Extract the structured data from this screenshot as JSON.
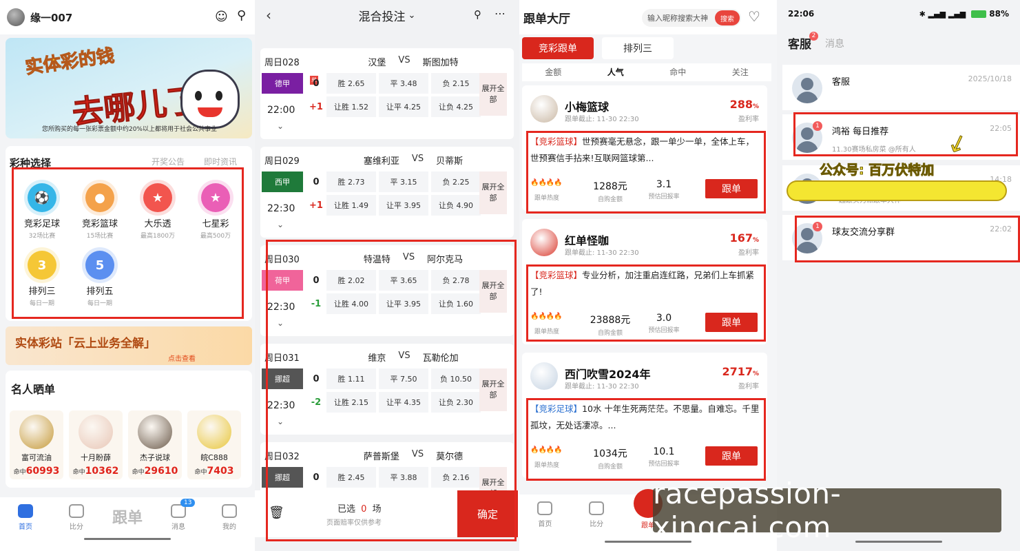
{
  "panel1": {
    "username": "缘一007",
    "banner": {
      "line1": "实体彩的钱",
      "line2": "去哪儿了?",
      "note": "您所购买的每一张彩票金额中约20%以上都将用于社会公共事业"
    },
    "section_title": "彩种选择",
    "section_links": [
      "开奖公告",
      "即时资讯"
    ],
    "lotteries": [
      {
        "name": "竞彩足球",
        "sub": "32场比赛",
        "color": "#35b6e8",
        "glyph": "⚽"
      },
      {
        "name": "竞彩篮球",
        "sub": "15场比赛",
        "color": "#f4a24b",
        "glyph": "●"
      },
      {
        "name": "大乐透",
        "sub": "最高1800万",
        "color": "#f2554e",
        "glyph": "★"
      },
      {
        "name": "七星彩",
        "sub": "最高500万",
        "color": "#ea5fb6",
        "glyph": "★"
      },
      {
        "name": "排列三",
        "sub": "每日一期",
        "color": "#f5c736",
        "glyph": "3"
      },
      {
        "name": "排列五",
        "sub": "每日一期",
        "color": "#5b8ff0",
        "glyph": "5"
      }
    ],
    "promo": {
      "title": "实体彩站「云上业务全解」",
      "link": "点击查看"
    },
    "celeb_title": "名人晒单",
    "celebs": [
      {
        "name": "富可流油",
        "hit_label": "命中",
        "hit": "60993"
      },
      {
        "name": "十月盼薛",
        "hit_label": "命中",
        "hit": "10362"
      },
      {
        "name": "杰子说球",
        "hit_label": "命中",
        "hit": "29610"
      },
      {
        "name": "皖C888",
        "hit_label": "命中",
        "hit": "7403"
      }
    ],
    "tabs": [
      {
        "label": "首页",
        "active": true
      },
      {
        "label": "比分"
      },
      {
        "label": "跟单"
      },
      {
        "label": "消息",
        "badge": "13"
      },
      {
        "label": "我的"
      }
    ]
  },
  "panel2": {
    "title": "混合投注",
    "matches": [
      {
        "week": "周日028",
        "league": "德甲",
        "league_color": "#7a1fa2",
        "time": "22:00",
        "home": "汉堡",
        "away": "斯图加特",
        "h0": "0",
        "h1": "+1",
        "odds": [
          "胜 2.65",
          "平 3.48",
          "负 2.15"
        ],
        "hodds": [
          "让胜 1.52",
          "让平 4.25",
          "让负 4.25"
        ],
        "flag": "单"
      },
      {
        "week": "周日029",
        "league": "西甲",
        "league_color": "#1f7a3a",
        "time": "22:30",
        "home": "塞维利亚",
        "away": "贝蒂斯",
        "h0": "0",
        "h1": "+1",
        "odds": [
          "胜 2.73",
          "平 3.15",
          "负 2.25"
        ],
        "hodds": [
          "让胜 1.49",
          "让平 3.95",
          "让负 4.90"
        ]
      },
      {
        "week": "周日030",
        "league": "荷甲",
        "league_color": "#f0649a",
        "time": "22:30",
        "home": "特温特",
        "away": "阿尔克马",
        "h0": "0",
        "h1": "-1",
        "odds": [
          "胜 2.02",
          "平 3.65",
          "负 2.78"
        ],
        "hodds": [
          "让胜 4.00",
          "让平 3.95",
          "让负 1.60"
        ]
      },
      {
        "week": "周日031",
        "league": "挪超",
        "league_color": "#555555",
        "time": "22:30",
        "home": "维京",
        "away": "瓦勒伦加",
        "h0": "0",
        "h1": "-2",
        "odds": [
          "胜 1.11",
          "平 7.50",
          "负 10.50"
        ],
        "hodds": [
          "让胜 2.15",
          "让平 4.35",
          "让负 2.30"
        ]
      },
      {
        "week": "周日032",
        "league": "挪超",
        "league_color": "#555555",
        "time": "",
        "home": "萨普斯堡",
        "away": "莫尔德",
        "h0": "0",
        "h1": "",
        "odds": [
          "胜 2.45",
          "平 3.88",
          "负 2.16"
        ],
        "hodds": [
          "",
          "",
          ""
        ]
      }
    ],
    "vs": "VS",
    "expand": "展开全部",
    "selected_prefix": "已选",
    "selected_count": "0",
    "selected_suffix": "场",
    "note": "页面赔率仅供参考",
    "confirm": "确定"
  },
  "panel3": {
    "title": "跟单大厅",
    "search_placeholder": "输入昵称搜索大神",
    "search_button": "搜索",
    "seg_active": "竞彩跟单",
    "seg_other": "排列三",
    "subtabs": [
      "金额",
      "人气",
      "命中",
      "关注"
    ],
    "users": [
      {
        "name": "小梅篮球",
        "deadline": "跟单截止: 11-30 22:30",
        "rate": "288",
        "rate_label": "盈利率",
        "tag": "【竞彩篮球】",
        "text": "世预赛毫无悬念，跟一单少一单，全体上车，世预赛信手拈来!互联网篮球第...",
        "amount": "1288元",
        "amount_label": "自购金额",
        "ret": "3.1",
        "ret_label": "预估回报率",
        "heat_label": "跟单热度",
        "follow": "跟单",
        "tag_color": "red"
      },
      {
        "name": "红单怪咖",
        "deadline": "跟单截止: 11-30 22:30",
        "rate": "167",
        "rate_label": "盈利率",
        "tag": "【竞彩篮球】",
        "text": "专业分析，加注重启连红路，兄弟们上车抓紧了!",
        "amount": "23888元",
        "amount_label": "自购金额",
        "ret": "3.0",
        "ret_label": "预估回报率",
        "heat_label": "跟单热度",
        "follow": "跟单",
        "tag_color": "red"
      },
      {
        "name": "西门吹雪2024年",
        "deadline": "跟单截止: 11-30 22:30",
        "rate": "2717",
        "rate_label": "盈利率",
        "tag": "【竞彩足球】",
        "text": "10水 十年生死两茫茫。不思量。自难忘。千里孤坟，无处话凄凉。...",
        "amount": "1034元",
        "amount_label": "自购金额",
        "ret": "10.1",
        "ret_label": "预估回报率",
        "heat_label": "跟单热度",
        "follow": "跟单",
        "tag_color": "blue"
      }
    ],
    "percent": "%",
    "tabs": [
      "首页",
      "比分",
      "跟单",
      "",
      ""
    ]
  },
  "panel4": {
    "time": "22:06",
    "battery": "88%",
    "tab_active": "客服",
    "tab_badge": "2",
    "tab_other": "消息",
    "chats": [
      {
        "name": "客服",
        "time": "2025/10/18",
        "sub": ""
      },
      {
        "name": "鸿裕 每日推荐",
        "time": "22:05",
        "sub": "11.30赛场私房菜 @所有人",
        "badge": "1"
      },
      {
        "name": "",
        "time": "14:18",
        "sub": "一起跟实力派跟单大神"
      },
      {
        "name": "球友交流分享群",
        "time": "22:02",
        "sub": "",
        "badge": "1"
      }
    ],
    "overlay": "公众号: 百万伏特加"
  },
  "watermark": "racepassion-xingcai.com"
}
